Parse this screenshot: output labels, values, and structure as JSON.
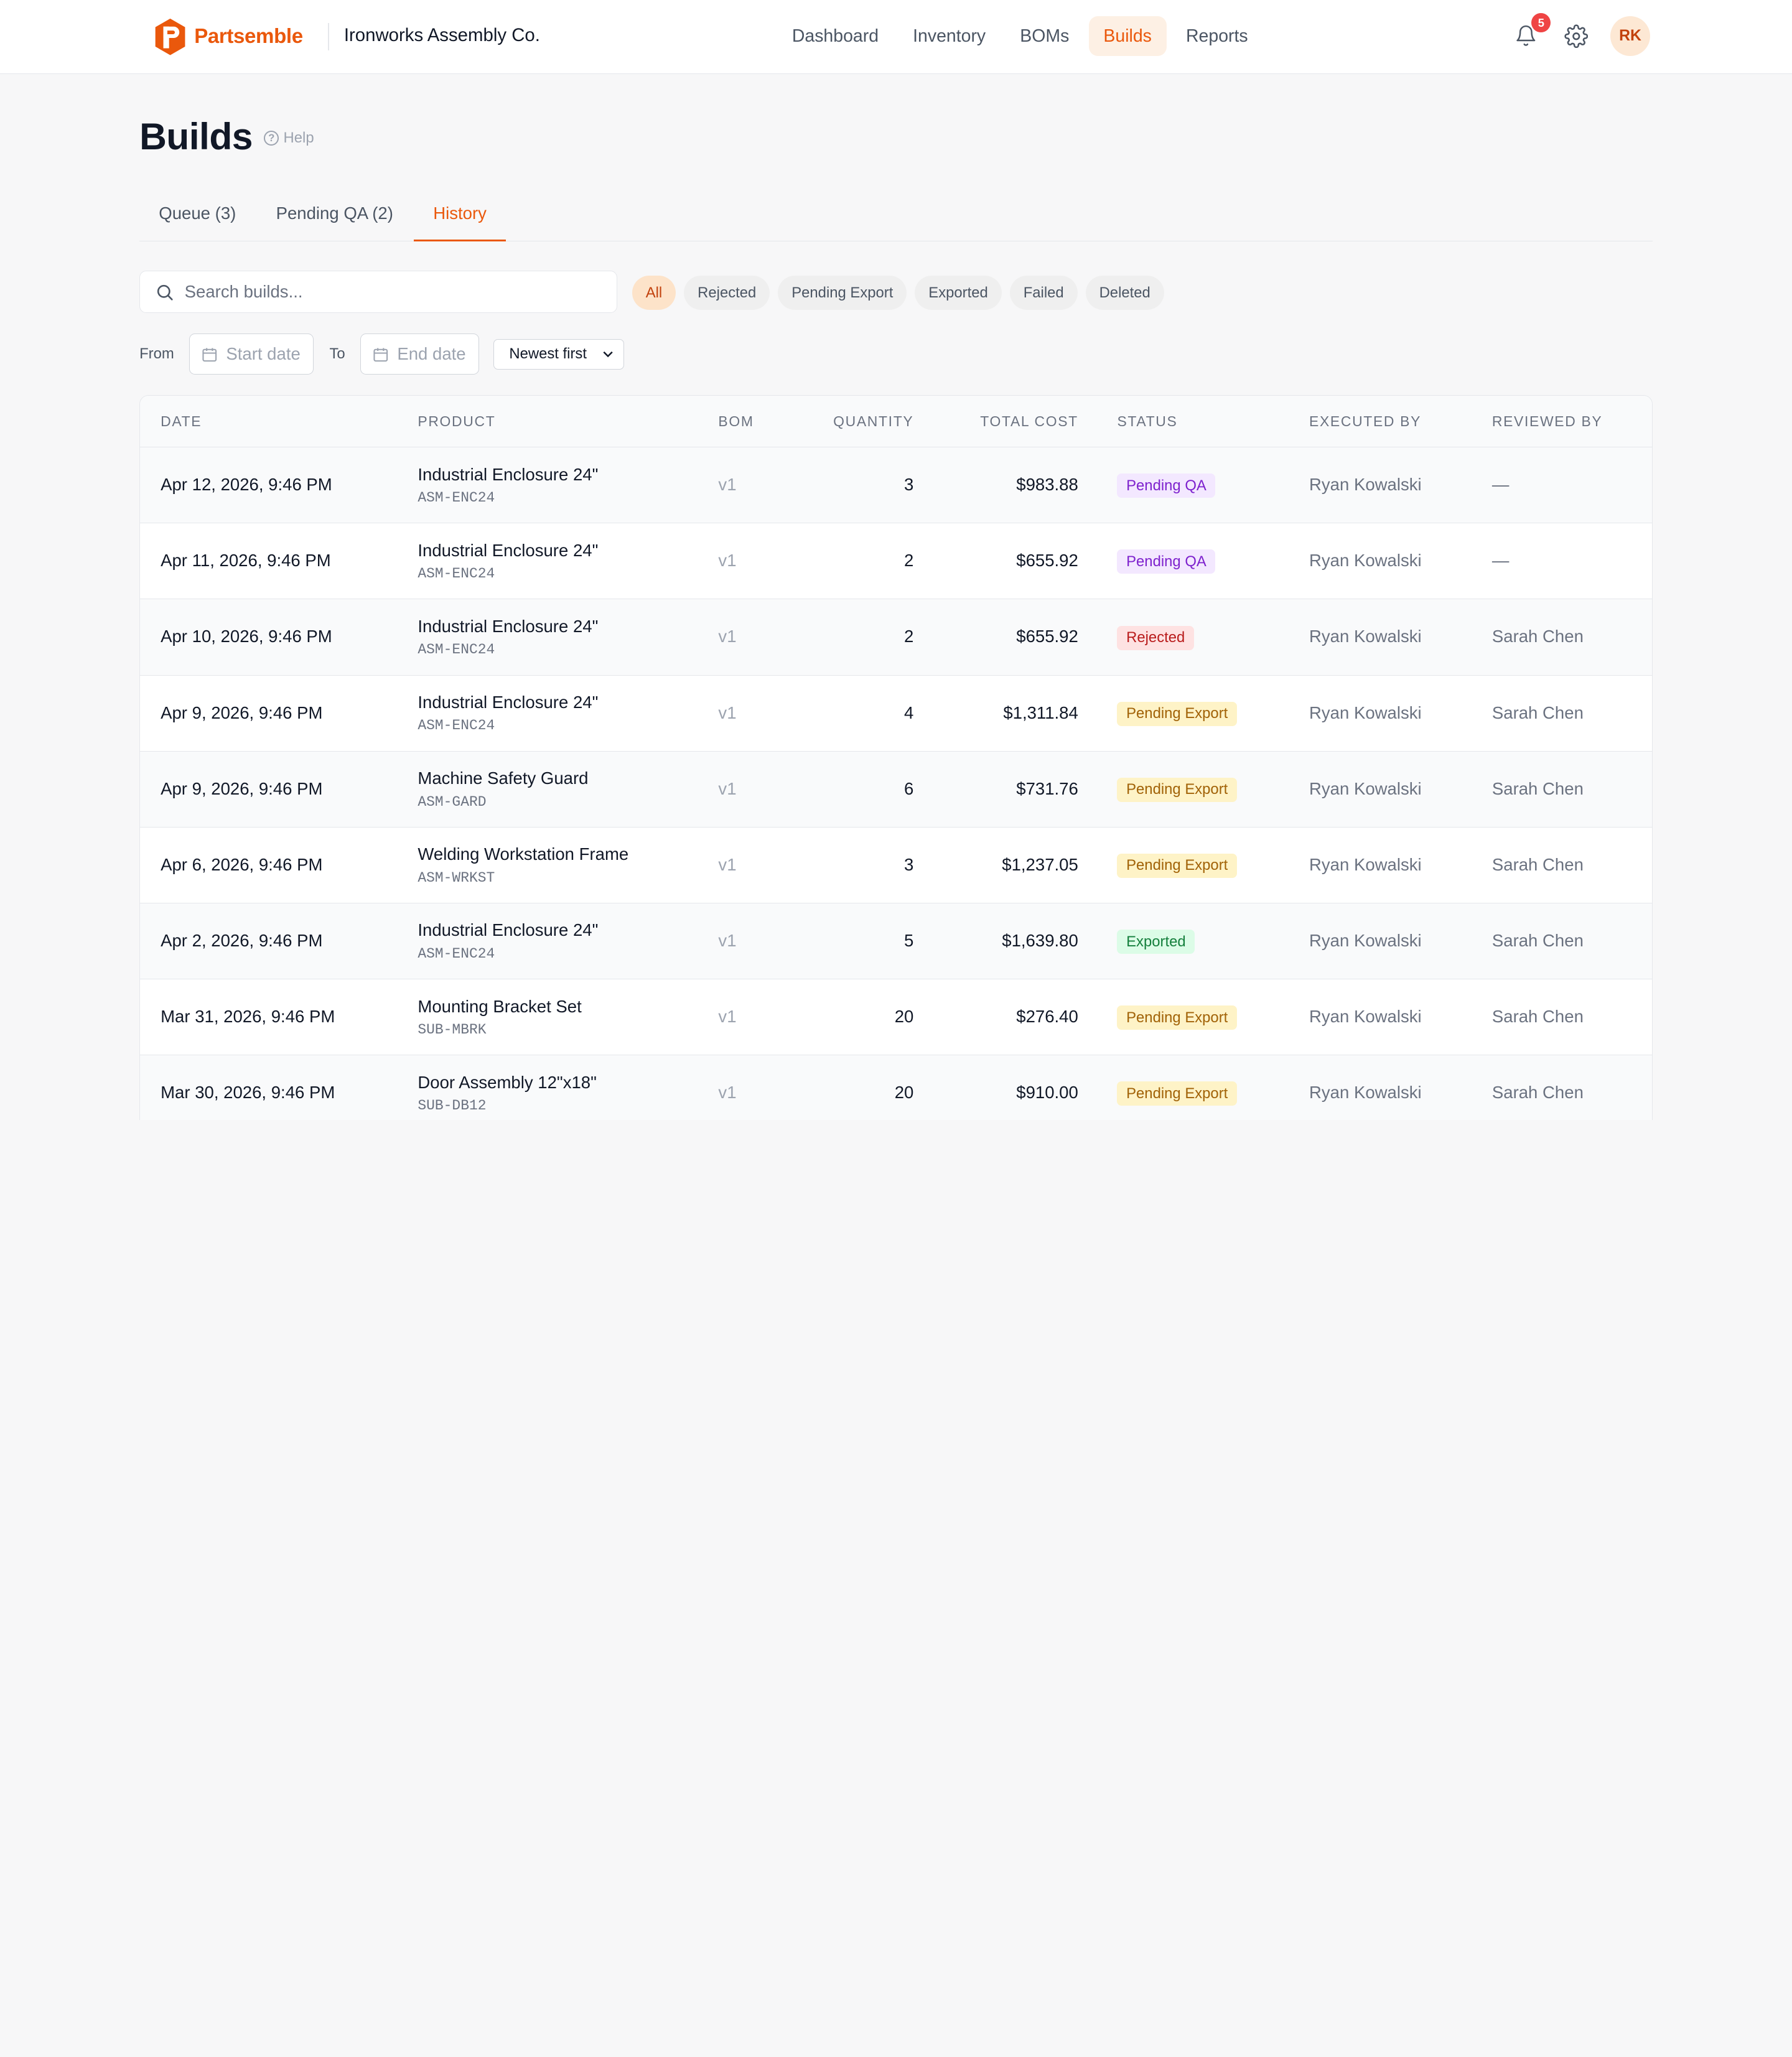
{
  "header": {
    "brand": "Partsemble",
    "org": "Ironworks Assembly Co.",
    "nav": [
      "Dashboard",
      "Inventory",
      "BOMs",
      "Builds",
      "Reports"
    ],
    "active_nav": "Builds",
    "notification_count": "5",
    "user_initials": "RK",
    "accent": "#ea580c"
  },
  "page": {
    "title": "Builds",
    "help": "Help"
  },
  "tabs": [
    "Queue (3)",
    "Pending QA (2)",
    "History"
  ],
  "active_tab": "History",
  "filters": {
    "search_placeholder": "Search builds...",
    "status_chips": [
      "All",
      "Rejected",
      "Pending Export",
      "Exported",
      "Failed",
      "Deleted"
    ],
    "from_label": "From",
    "start_placeholder": "Start date",
    "to_label": "To",
    "end_placeholder": "End date",
    "sort": "Newest first"
  },
  "table": {
    "columns": [
      "Date",
      "Product",
      "BOM",
      "Quantity",
      "Total Cost",
      "Status",
      "Executed By",
      "Reviewed By"
    ],
    "rows": [
      {
        "date": "Apr 12, 2026, 9:46 PM",
        "product": "Industrial Enclosure 24\"",
        "sku": "ASM-ENC24",
        "bom": "v1",
        "qty": "3",
        "cost": "$983.88",
        "status": "Pending QA",
        "status_kind": "qa",
        "executed": "Ryan Kowalski",
        "reviewed": "—"
      },
      {
        "date": "Apr 11, 2026, 9:46 PM",
        "product": "Industrial Enclosure 24\"",
        "sku": "ASM-ENC24",
        "bom": "v1",
        "qty": "2",
        "cost": "$655.92",
        "status": "Pending QA",
        "status_kind": "qa",
        "executed": "Ryan Kowalski",
        "reviewed": "—"
      },
      {
        "date": "Apr 10, 2026, 9:46 PM",
        "product": "Industrial Enclosure 24\"",
        "sku": "ASM-ENC24",
        "bom": "v1",
        "qty": "2",
        "cost": "$655.92",
        "status": "Rejected",
        "status_kind": "rej",
        "executed": "Ryan Kowalski",
        "reviewed": "Sarah Chen"
      },
      {
        "date": "Apr 9, 2026, 9:46 PM",
        "product": "Industrial Enclosure 24\"",
        "sku": "ASM-ENC24",
        "bom": "v1",
        "qty": "4",
        "cost": "$1,311.84",
        "status": "Pending Export",
        "status_kind": "pe",
        "executed": "Ryan Kowalski",
        "reviewed": "Sarah Chen"
      },
      {
        "date": "Apr 9, 2026, 9:46 PM",
        "product": "Machine Safety Guard",
        "sku": "ASM-GARD",
        "bom": "v1",
        "qty": "6",
        "cost": "$731.76",
        "status": "Pending Export",
        "status_kind": "pe",
        "executed": "Ryan Kowalski",
        "reviewed": "Sarah Chen"
      },
      {
        "date": "Apr 6, 2026, 9:46 PM",
        "product": "Welding Workstation Frame",
        "sku": "ASM-WRKST",
        "bom": "v1",
        "qty": "3",
        "cost": "$1,237.05",
        "status": "Pending Export",
        "status_kind": "pe",
        "executed": "Ryan Kowalski",
        "reviewed": "Sarah Chen"
      },
      {
        "date": "Apr 2, 2026, 9:46 PM",
        "product": "Industrial Enclosure 24\"",
        "sku": "ASM-ENC24",
        "bom": "v1",
        "qty": "5",
        "cost": "$1,639.80",
        "status": "Exported",
        "status_kind": "ex",
        "executed": "Ryan Kowalski",
        "reviewed": "Sarah Chen"
      },
      {
        "date": "Mar 31, 2026, 9:46 PM",
        "product": "Mounting Bracket Set",
        "sku": "SUB-MBRK",
        "bom": "v1",
        "qty": "20",
        "cost": "$276.40",
        "status": "Pending Export",
        "status_kind": "pe",
        "executed": "Ryan Kowalski",
        "reviewed": "Sarah Chen"
      },
      {
        "date": "Mar 30, 2026, 9:46 PM",
        "product": "Door Assembly 12\"x18\"",
        "sku": "SUB-DB12",
        "bom": "v1",
        "qty": "20",
        "cost": "$910.00",
        "status": "Pending Export",
        "status_kind": "pe",
        "executed": "Ryan Kowalski",
        "reviewed": "Sarah Chen"
      }
    ]
  }
}
